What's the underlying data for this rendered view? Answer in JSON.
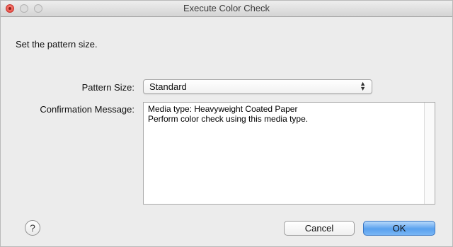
{
  "window": {
    "title": "Execute Color Check"
  },
  "instruction": "Set the pattern size.",
  "pattern_size": {
    "label": "Pattern Size:",
    "value": "Standard"
  },
  "confirmation": {
    "label": "Confirmation Message:",
    "line1": "Media type: Heavyweight Coated Paper",
    "line2": "Perform color check using this media type."
  },
  "buttons": {
    "help_label": "?",
    "cancel_label": "Cancel",
    "ok_label": "OK"
  },
  "icons": {
    "close": "close-icon",
    "minimize": "minimize-icon",
    "maximize": "maximize-icon",
    "select_arrows": "up-down-arrows-icon",
    "help": "question-mark-icon"
  },
  "colors": {
    "default_button": "#5aa1ee",
    "close_button": "#e0443e"
  }
}
